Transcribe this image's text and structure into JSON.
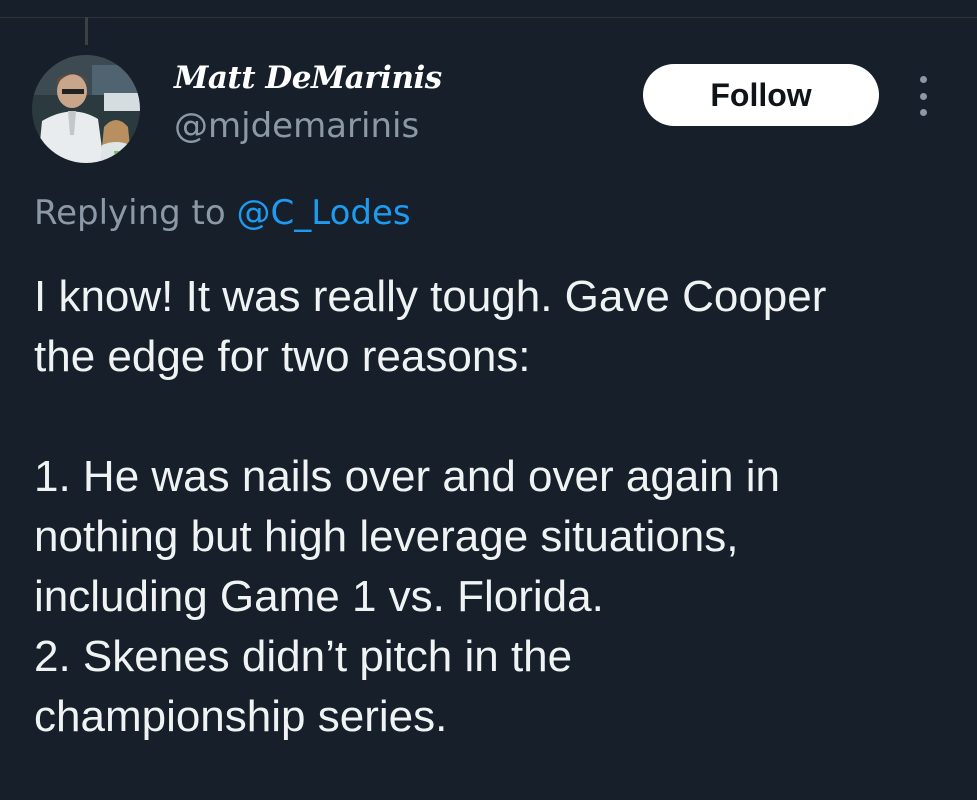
{
  "colors": {
    "background": "#17202a",
    "text": "#eff3f4",
    "secondary_text": "#8b98a5",
    "link": "#1d9bf0",
    "follow_button_bg": "#ffffff",
    "follow_button_text": "#0f1419"
  },
  "author": {
    "display_name": "Matt DeMarinis",
    "handle": "@mjdemarinis",
    "avatar_icon": "user-avatar-photo"
  },
  "actions": {
    "follow_label": "Follow",
    "more_icon": "more-vertical-icon"
  },
  "reply": {
    "prefix": "Replying to ",
    "mention": "@C_Lodes"
  },
  "tweet": {
    "lines": [
      "I know! It was really tough. Gave Cooper",
      "the edge for two reasons:",
      "",
      "1. He was nails over and over again in",
      "nothing but high leverage situations,",
      "including Game 1 vs. Florida.",
      "2. Skenes didn’t pitch in the",
      "championship series."
    ]
  }
}
